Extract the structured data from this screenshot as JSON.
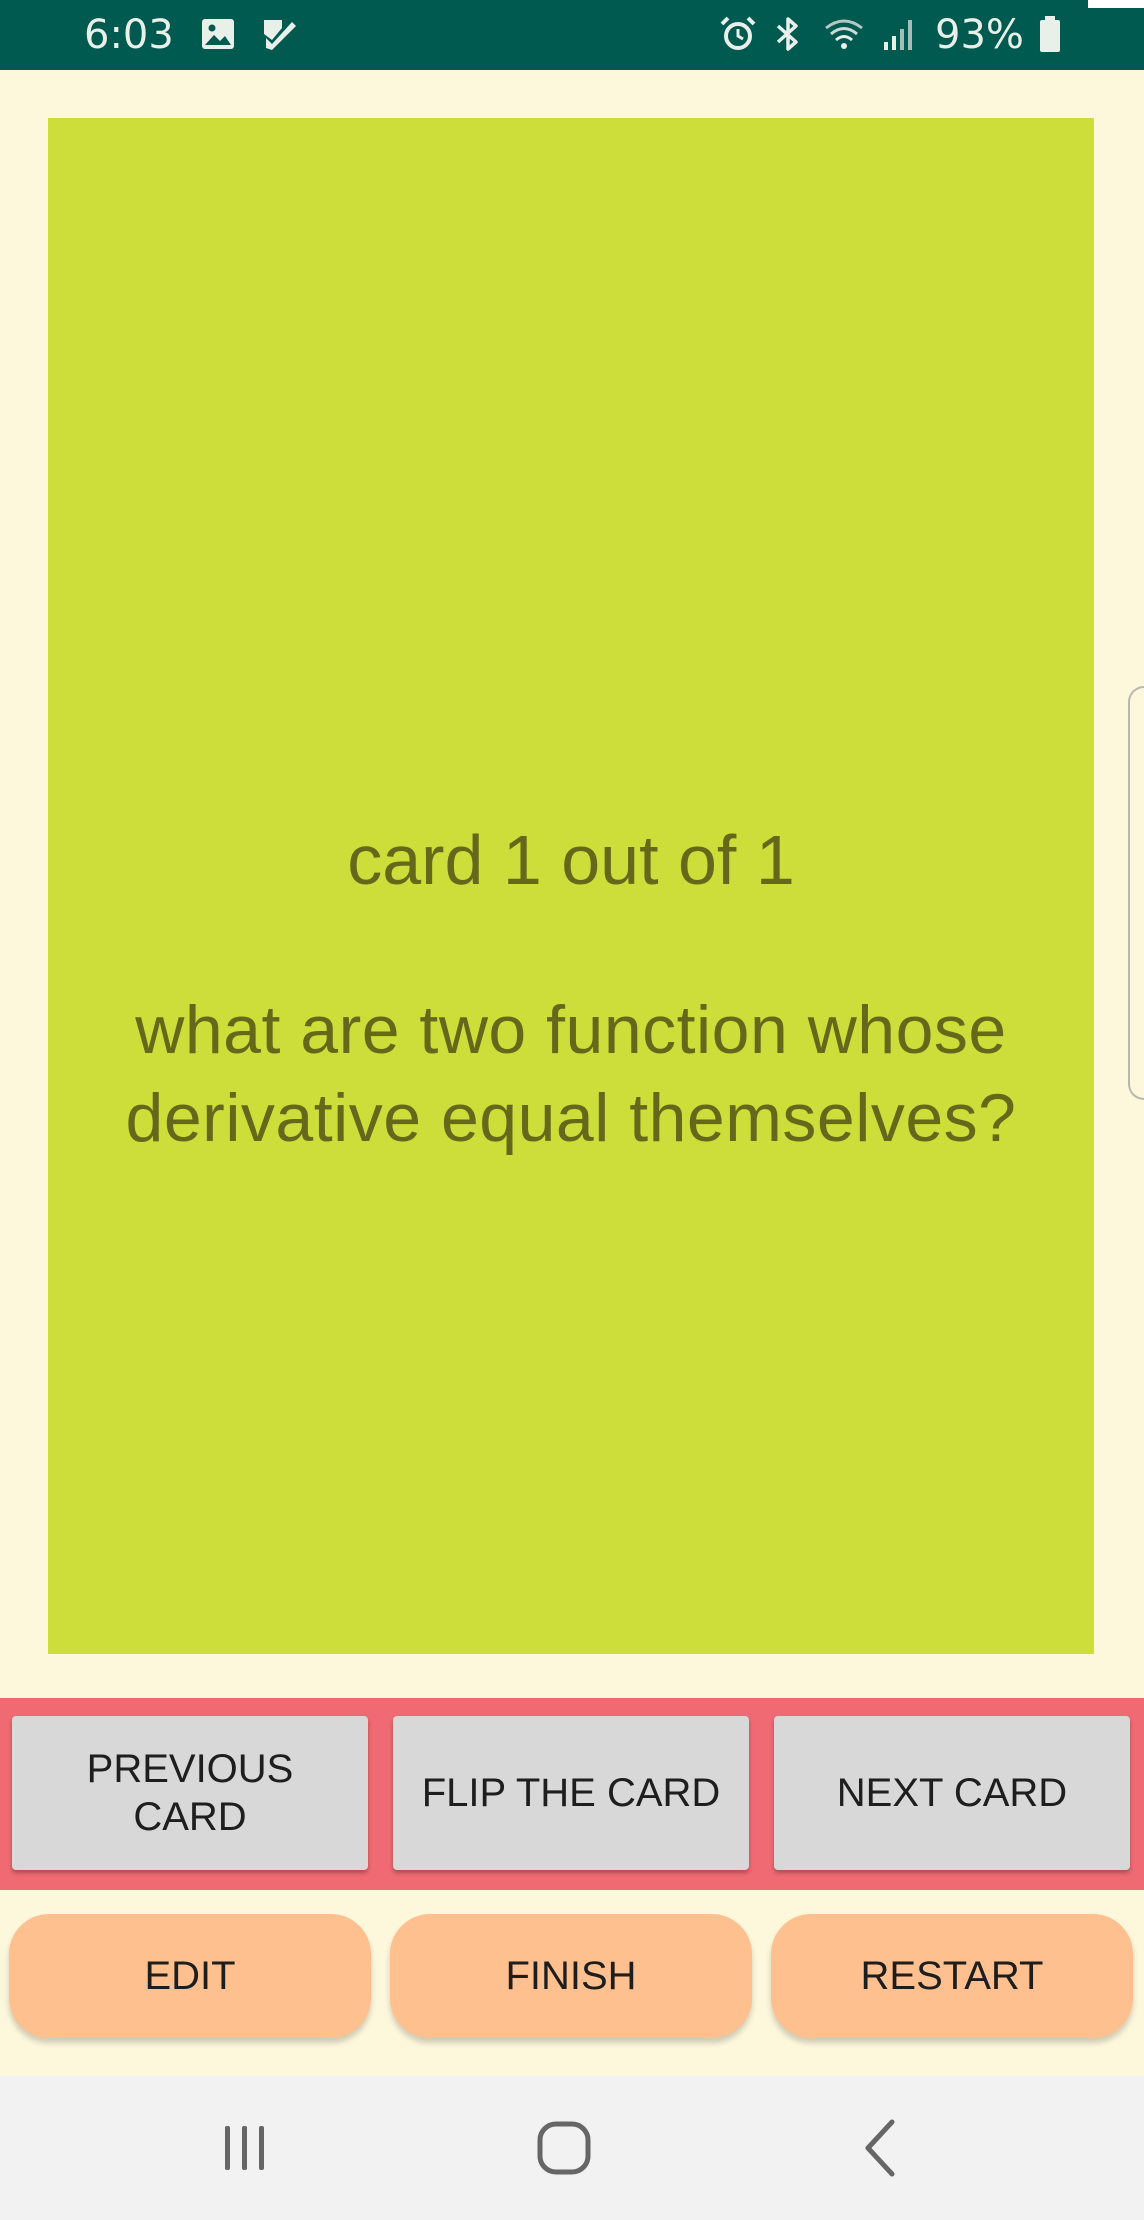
{
  "status_bar": {
    "time": "6:03",
    "battery_percent": "93%",
    "icons": [
      "image-icon",
      "check-task-icon",
      "alarm-icon",
      "bluetooth-icon",
      "wifi-icon",
      "signal-icon",
      "battery-icon"
    ],
    "background_color": "#005a50"
  },
  "card": {
    "counter_text": "card 1 out of 1",
    "question_text": "what are two function whose derivative equal themselves?",
    "background_color": "#cddd39",
    "text_color": "#65681a"
  },
  "nav_buttons": {
    "previous_label": "PREVIOUS CARD",
    "flip_label": "FLIP THE CARD",
    "next_label": "NEXT CARD",
    "band_color": "#f06a73",
    "button_color": "#d8d8d8"
  },
  "action_buttons": {
    "edit_label": "EDIT",
    "finish_label": "FINISH",
    "restart_label": "RESTART",
    "button_color": "#ffc08f"
  },
  "system_nav": {
    "icons": [
      "recent-apps-icon",
      "home-icon",
      "back-icon"
    ]
  },
  "app_background_color": "#fdf7dc"
}
